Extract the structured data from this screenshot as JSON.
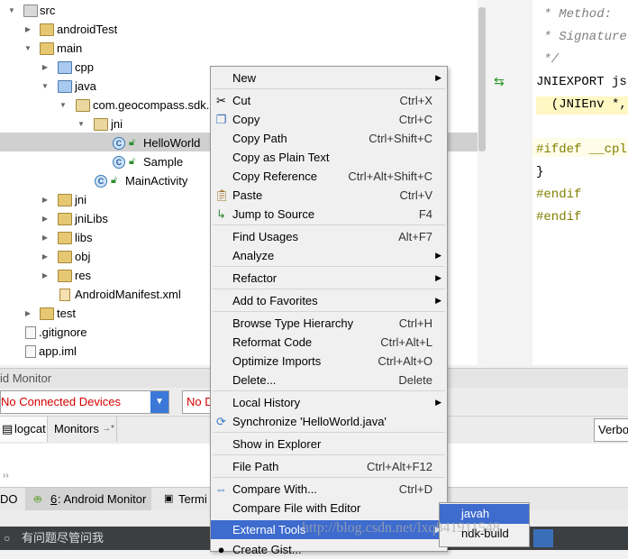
{
  "project_tree": {
    "items": [
      {
        "label": "src",
        "kind": "src"
      },
      {
        "label": "androidTest",
        "kind": "folder"
      },
      {
        "label": "main",
        "kind": "folder"
      },
      {
        "label": "cpp",
        "kind": "blue-folder"
      },
      {
        "label": "java",
        "kind": "blue-folder"
      },
      {
        "label": "com.geocompass.sdk.",
        "kind": "package"
      },
      {
        "label": "jni",
        "kind": "package"
      },
      {
        "label": "HelloWorld",
        "kind": "class",
        "selected": true
      },
      {
        "label": "Sample",
        "kind": "class"
      },
      {
        "label": "MainActivity",
        "kind": "class"
      },
      {
        "label": "jni",
        "kind": "folder"
      },
      {
        "label": "jniLibs",
        "kind": "folder"
      },
      {
        "label": "libs",
        "kind": "folder"
      },
      {
        "label": "obj",
        "kind": "folder"
      },
      {
        "label": "res",
        "kind": "folder"
      },
      {
        "label": "AndroidManifest.xml",
        "kind": "file"
      },
      {
        "label": "test",
        "kind": "folder"
      },
      {
        "label": ".gitignore",
        "kind": "file"
      },
      {
        "label": "app.iml",
        "kind": "file"
      }
    ],
    "class_icon_letter": "C"
  },
  "editor": {
    "lines": [
      " * Method:",
      " * Signature:",
      " */",
      "JNIEXPORT jst",
      "  (JNIEnv *,",
      "",
      "#ifdef __cplu",
      "}",
      "#endif",
      "#endif"
    ]
  },
  "bottom": {
    "monitor_title": "id Monitor",
    "device_combo": "No Connected Devices",
    "process_combo": "No D",
    "tab_logcat": "logcat",
    "tab_monitors": "Monitors",
    "verbose": "Verbo",
    "tool_todo": "DO",
    "tool_android_monitor_num": "6",
    "tool_android_monitor": ": Android Monitor",
    "tool_terminal": "Termi",
    "status_text": "有问题尽管问我"
  },
  "context_menu": {
    "items": [
      {
        "label": "New",
        "submenu": true
      },
      {
        "label": "Cut",
        "shortcut": "Ctrl+X",
        "icon": "scissors-icon"
      },
      {
        "label": "Copy",
        "shortcut": "Ctrl+C",
        "icon": "copy-icon"
      },
      {
        "label": "Copy Path",
        "shortcut": "Ctrl+Shift+C"
      },
      {
        "label": "Copy as Plain Text",
        "shortcut": ""
      },
      {
        "label": "Copy Reference",
        "shortcut": "Ctrl+Alt+Shift+C"
      },
      {
        "label": "Paste",
        "shortcut": "Ctrl+V",
        "icon": "paste-icon"
      },
      {
        "label": "Jump to Source",
        "shortcut": "F4",
        "icon": "jump-icon"
      },
      {
        "label": "Find Usages",
        "shortcut": "Alt+F7"
      },
      {
        "label": "Analyze",
        "submenu": true
      },
      {
        "label": "Refactor",
        "submenu": true
      },
      {
        "label": "Add to Favorites",
        "submenu": true
      },
      {
        "label": "Browse Type Hierarchy",
        "shortcut": "Ctrl+H"
      },
      {
        "label": "Reformat Code",
        "shortcut": "Ctrl+Alt+L"
      },
      {
        "label": "Optimize Imports",
        "shortcut": "Ctrl+Alt+O"
      },
      {
        "label": "Delete...",
        "shortcut": "Delete"
      },
      {
        "label": "Local History",
        "submenu": true
      },
      {
        "label": "Synchronize 'HelloWorld.java'",
        "icon": "sync-icon"
      },
      {
        "label": "Show in Explorer"
      },
      {
        "label": "File Path",
        "shortcut": "Ctrl+Alt+F12"
      },
      {
        "label": "Compare With...",
        "shortcut": "Ctrl+D",
        "icon": "compare-icon"
      },
      {
        "label": "Compare File with Editor"
      },
      {
        "label": "External Tools",
        "submenu": true,
        "highlighted": true
      },
      {
        "label": "Create Gist..."
      }
    ]
  },
  "external_tools_submenu": {
    "items": [
      {
        "label": "javah",
        "highlighted": true
      },
      {
        "label": "ndk-build"
      }
    ]
  },
  "watermark": "http://blog.csdn.net/lxq841911548",
  "colors": {
    "menu_highlight": "#3d6bce",
    "selected_row": "#d0d0d0",
    "status_bar": "#3c3f41",
    "device_text": "#d40000"
  }
}
